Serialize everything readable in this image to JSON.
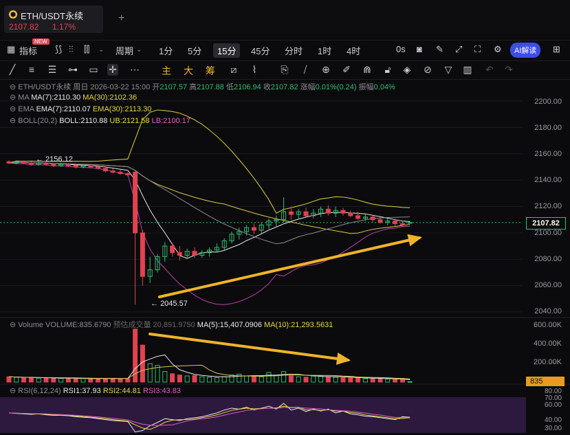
{
  "tab": {
    "coin_letter": "⬢",
    "symbol": "ETH/USDT永续",
    "price": "2107.82",
    "change_pct": "1.17%",
    "add_tab": "+"
  },
  "toolbar": {
    "indicators_label": "指标",
    "new_badge": "NEW",
    "period_label": "周期",
    "intervals": [
      "1分",
      "5分",
      "15分",
      "45分",
      "分时",
      "1时",
      "4时"
    ],
    "active_interval": "15分",
    "right_label": "0s",
    "ai_label": "AI解读"
  },
  "drawing_tools": {
    "main_label": "主",
    "large_label": "大",
    "chips_label": "筹"
  },
  "header": {
    "symbol": "ETH/USDT永续",
    "period": "周日",
    "datetime": "2026-03-22 15:00",
    "open_label": "开",
    "open": "2107.57",
    "high_label": "高",
    "high": "2107.88",
    "low_label": "低",
    "low": "2106.94",
    "close_label": "收",
    "close": "2107.82",
    "change_label": "涨幅",
    "change": "0.01%(0.24)",
    "amp_label": "振幅",
    "amp": "0.04%"
  },
  "ma": {
    "name": "MA",
    "ma7": "MA(7):2110.30",
    "ma30": "MA(30):2102.36"
  },
  "ema": {
    "name": "EMA",
    "ema7": "EMA(7):2110.07",
    "ema30": "EMA(30):2113.30"
  },
  "boll": {
    "name": "BOLL(20,2)",
    "mid": "BOLL:2110.88",
    "ub": "UB:2121.58",
    "lb": "LB:2100.17"
  },
  "volume": {
    "name": "Volume",
    "value": "VOLUME:835.6790",
    "est": "预估成交量 20,891.9750",
    "ma5": "MA(5):15,407.0906",
    "ma10": "MA(10):21,293.5631",
    "badge": "835"
  },
  "rsi": {
    "name": "RSI(6,12,24)",
    "rsi1": "RSI1:37.93",
    "rsi2": "RSI2:44.81",
    "rsi3": "RSI3:43.83"
  },
  "price_axis": [
    "2200.00",
    "2180.00",
    "2160.00",
    "2140.00",
    "2120.00",
    "2100.00",
    "2080.00",
    "2060.00",
    "2040.00"
  ],
  "current_price": "2107.82",
  "volume_axis": [
    "600.00K",
    "400.00K",
    "200.00K"
  ],
  "rsi_axis": [
    "80.00",
    "70.00",
    "60.00",
    "40.00",
    "30.00"
  ],
  "annotations": {
    "high_mark": "2156.12",
    "low_mark": "2045.57"
  },
  "colors": {
    "up": "#2fbf71",
    "down": "#e2434f",
    "accent": "#f0b429",
    "ai": "#3c4de8"
  },
  "chart_data": {
    "type": "candlestick",
    "ylim": [
      2040,
      2200
    ],
    "candles": [
      [
        2154,
        2155,
        2152,
        2153
      ],
      [
        2153,
        2155,
        2152,
        2154
      ],
      [
        2154,
        2155,
        2152,
        2153
      ],
      [
        2153,
        2154,
        2151,
        2152
      ],
      [
        2152,
        2154,
        2151,
        2153
      ],
      [
        2153,
        2154,
        2151,
        2152
      ],
      [
        2152,
        2153,
        2150,
        2151
      ],
      [
        2151,
        2153,
        2150,
        2152
      ],
      [
        2152,
        2153,
        2150,
        2151
      ],
      [
        2151,
        2152,
        2149,
        2150
      ],
      [
        2150,
        2152,
        2149,
        2151
      ],
      [
        2151,
        2152,
        2149,
        2150
      ],
      [
        2150,
        2151,
        2148,
        2149
      ],
      [
        2149,
        2150,
        2146,
        2147
      ],
      [
        2147,
        2149,
        2145,
        2146
      ],
      [
        2146,
        2148,
        2144,
        2145
      ],
      [
        2145,
        2146,
        2143,
        2144
      ],
      [
        2146,
        2147,
        2045.57,
        2100
      ],
      [
        2100,
        2102,
        2060,
        2067
      ],
      [
        2067,
        2082,
        2062,
        2072
      ],
      [
        2072,
        2084,
        2070,
        2082
      ],
      [
        2082,
        2093,
        2078,
        2090
      ],
      [
        2090,
        2092,
        2082,
        2085
      ],
      [
        2085,
        2090,
        2079,
        2083
      ],
      [
        2083,
        2088,
        2080,
        2086
      ],
      [
        2086,
        2089,
        2081,
        2083
      ],
      [
        2083,
        2087,
        2081,
        2085
      ],
      [
        2085,
        2089,
        2082,
        2087
      ],
      [
        2087,
        2092,
        2085,
        2089
      ],
      [
        2089,
        2096,
        2087,
        2094
      ],
      [
        2094,
        2101,
        2092,
        2099
      ],
      [
        2099,
        2104,
        2095,
        2101
      ],
      [
        2101,
        2106,
        2098,
        2104
      ],
      [
        2104,
        2107,
        2099,
        2102
      ],
      [
        2102,
        2108,
        2100,
        2106
      ],
      [
        2106,
        2111,
        2103,
        2109
      ],
      [
        2109,
        2113,
        2105,
        2110
      ],
      [
        2110,
        2127,
        2108,
        2116
      ],
      [
        2116,
        2120,
        2110,
        2114
      ],
      [
        2114,
        2118,
        2110,
        2116
      ],
      [
        2116,
        2119,
        2112,
        2113
      ],
      [
        2113,
        2118,
        2111,
        2115
      ],
      [
        2115,
        2120,
        2112,
        2118
      ],
      [
        2118,
        2121,
        2113,
        2115
      ],
      [
        2115,
        2120,
        2112,
        2117
      ],
      [
        2117,
        2119,
        2113,
        2115
      ],
      [
        2115,
        2117,
        2112,
        2113
      ],
      [
        2113,
        2116,
        2110,
        2111
      ],
      [
        2111,
        2114,
        2109,
        2112
      ],
      [
        2112,
        2114,
        2108,
        2110
      ],
      [
        2110,
        2112,
        2107,
        2108
      ],
      [
        2108,
        2111,
        2106,
        2109
      ],
      [
        2109,
        2111,
        2105,
        2107
      ],
      [
        2107,
        2109,
        2105,
        2106
      ],
      [
        2107.57,
        2107.88,
        2106.94,
        2107.82
      ]
    ],
    "volume": [
      60,
      55,
      50,
      48,
      45,
      50,
      45,
      42,
      40,
      38,
      42,
      40,
      38,
      40,
      42,
      38,
      40,
      600,
      420,
      210,
      190,
      120,
      95,
      80,
      70,
      75,
      60,
      55,
      50,
      60,
      80,
      90,
      70,
      65,
      60,
      110,
      80,
      120,
      70,
      60,
      55,
      65,
      70,
      60,
      55,
      50,
      48,
      45,
      40,
      42,
      38,
      35,
      30,
      28,
      5
    ],
    "rsi": [
      52,
      51,
      50,
      49,
      50,
      48,
      47,
      47,
      46,
      44,
      43,
      42,
      40,
      38,
      36,
      35,
      34,
      12,
      15,
      25,
      32,
      40,
      38,
      36,
      40,
      42,
      44,
      48,
      52,
      58,
      62,
      60,
      64,
      58,
      62,
      66,
      60,
      72,
      58,
      62,
      55,
      60,
      56,
      60,
      52,
      56,
      50,
      48,
      45,
      44,
      42,
      40,
      38,
      44,
      43
    ]
  }
}
